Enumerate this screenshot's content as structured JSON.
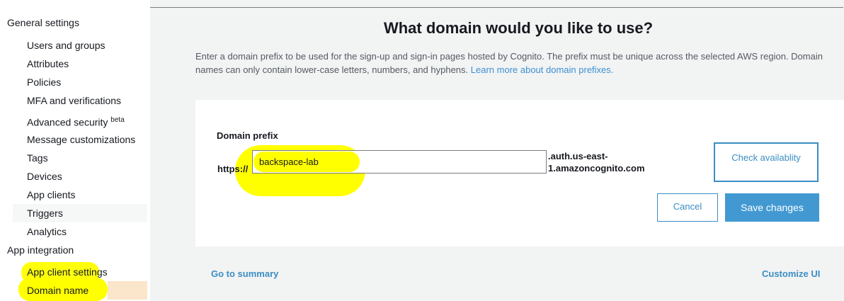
{
  "sidebar": {
    "general_settings": "General settings",
    "items": [
      {
        "label": "Users and groups"
      },
      {
        "label": "Attributes"
      },
      {
        "label": "Policies"
      },
      {
        "label": "MFA and verifications"
      },
      {
        "label": "Advanced security",
        "badge": "beta"
      },
      {
        "label": "Message customizations"
      },
      {
        "label": "Tags"
      },
      {
        "label": "Devices"
      },
      {
        "label": "App clients"
      },
      {
        "label": "Triggers"
      },
      {
        "label": "Analytics"
      }
    ],
    "app_integration": "App integration",
    "app_items": [
      {
        "label": "App client settings"
      },
      {
        "label": "Domain name"
      }
    ]
  },
  "main": {
    "title": "What domain would you like to use?",
    "description_text": "Enter a domain prefix to be used for the sign-up and sign-in pages hosted by Cognito. The prefix must be unique across the selected AWS region. Domain names can only contain lower-case letters, numbers, and hyphens.",
    "learn_more_link": "Learn more about domain prefixes.",
    "field_label": "Domain prefix",
    "https_prefix": "https://",
    "domain_value": "backspace-lab",
    "domain_suffix": ".auth.us-east-1.amazoncognito.com",
    "check_button": "Check availablity",
    "cancel_button": "Cancel",
    "save_button": "Save changes",
    "go_to_summary": "Go to summary",
    "customize_ui": "Customize UI"
  },
  "colors": {
    "accent": "#3b8ec4",
    "primary_button": "#4299d2",
    "active_nav": "#fbe5cb",
    "highlight_marker": "#ffff00"
  }
}
